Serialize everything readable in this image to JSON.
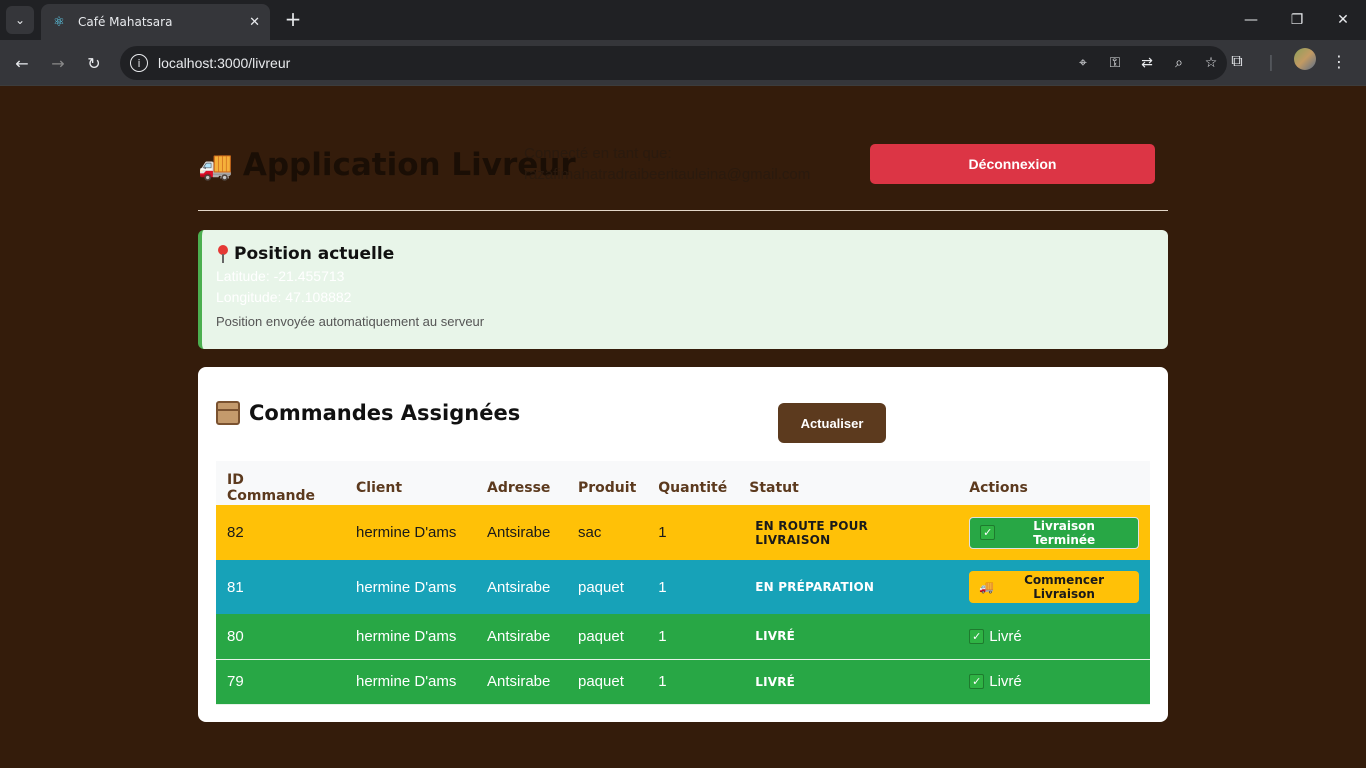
{
  "browser": {
    "tab_title": "Café Mahatsara",
    "url": "localhost:3000/livreur"
  },
  "header": {
    "title": "Application Livreur",
    "connected_label": "Connecté en tant que:",
    "email": "razafimahatradraibeeritauleina@gmail.com",
    "logout_label": "Déconnexion"
  },
  "position": {
    "title": "Position actuelle",
    "latitude": "Latitude: -21.455713",
    "longitude": "Longitude: 47.108882",
    "note": "Position envoyée automatiquement au serveur"
  },
  "orders": {
    "title": "Commandes Assignées",
    "refresh_label": "Actualiser",
    "columns": [
      "ID Commande",
      "Client",
      "Adresse",
      "Produit",
      "Quantité",
      "Statut",
      "Actions"
    ],
    "rows": [
      {
        "id": "82",
        "client": "hermine D'ams",
        "address": "Antsirabe",
        "product": "sac",
        "qty": "1",
        "status": "EN ROUTE POUR LIVRAISON",
        "action": "Livraison Terminée"
      },
      {
        "id": "81",
        "client": "hermine D'ams",
        "address": "Antsirabe",
        "product": "paquet",
        "qty": "1",
        "status": "EN PRÉPARATION",
        "action": "Commencer Livraison"
      },
      {
        "id": "80",
        "client": "hermine D'ams",
        "address": "Antsirabe",
        "product": "paquet",
        "qty": "1",
        "status": "LIVRÉ",
        "action": "Livré"
      },
      {
        "id": "79",
        "client": "hermine D'ams",
        "address": "Antsirabe",
        "product": "paquet",
        "qty": "1",
        "status": "LIVRÉ",
        "action": "Livré"
      }
    ]
  },
  "colors": {
    "page_bg": "#341c0b",
    "logout": "#dc3545",
    "en_route": "#ffc107",
    "preparation": "#17a2b8",
    "delivered": "#28a745"
  }
}
